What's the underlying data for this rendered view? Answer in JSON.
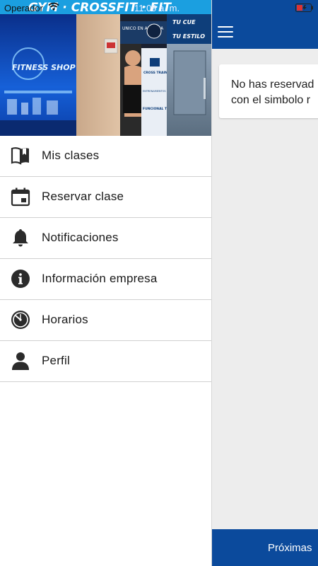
{
  "status_bar": {
    "carrier": "Operador",
    "time": "11:09 a. m."
  },
  "drawer": {
    "header_image_text": {
      "banner": "GYM · CROSSFIT · FIT",
      "shop_sign": "FITNESS SHOP",
      "poster_unico": "UNICO EN ALCUDIA",
      "poster_tu_cuerpo": "TU CUE",
      "poster_tu_estilo": "TU ESTILO",
      "poster_cross": "CROSS TRAINING HIIT",
      "poster_personal": "ENTRENAMIENTOS PERSONALES Y GRUPALES",
      "poster_funcional": "FUNCIONAL TRAINING"
    },
    "items": [
      {
        "label": "Mis clases",
        "icon": "book-icon"
      },
      {
        "label": "Reservar clase",
        "icon": "calendar-icon"
      },
      {
        "label": "Notificaciones",
        "icon": "bell-icon"
      },
      {
        "label": "Información empresa",
        "icon": "info-icon"
      },
      {
        "label": "Horarios",
        "icon": "clock-icon"
      },
      {
        "label": "Perfil",
        "icon": "person-icon"
      }
    ]
  },
  "main": {
    "info_line1": "No has reservad",
    "info_line2": "con el simbolo r",
    "bottom_tab": "Próximas"
  },
  "colors": {
    "brand_blue": "#0b4a9c",
    "background_gray": "#ededed",
    "divider": "#d0d0d0"
  }
}
